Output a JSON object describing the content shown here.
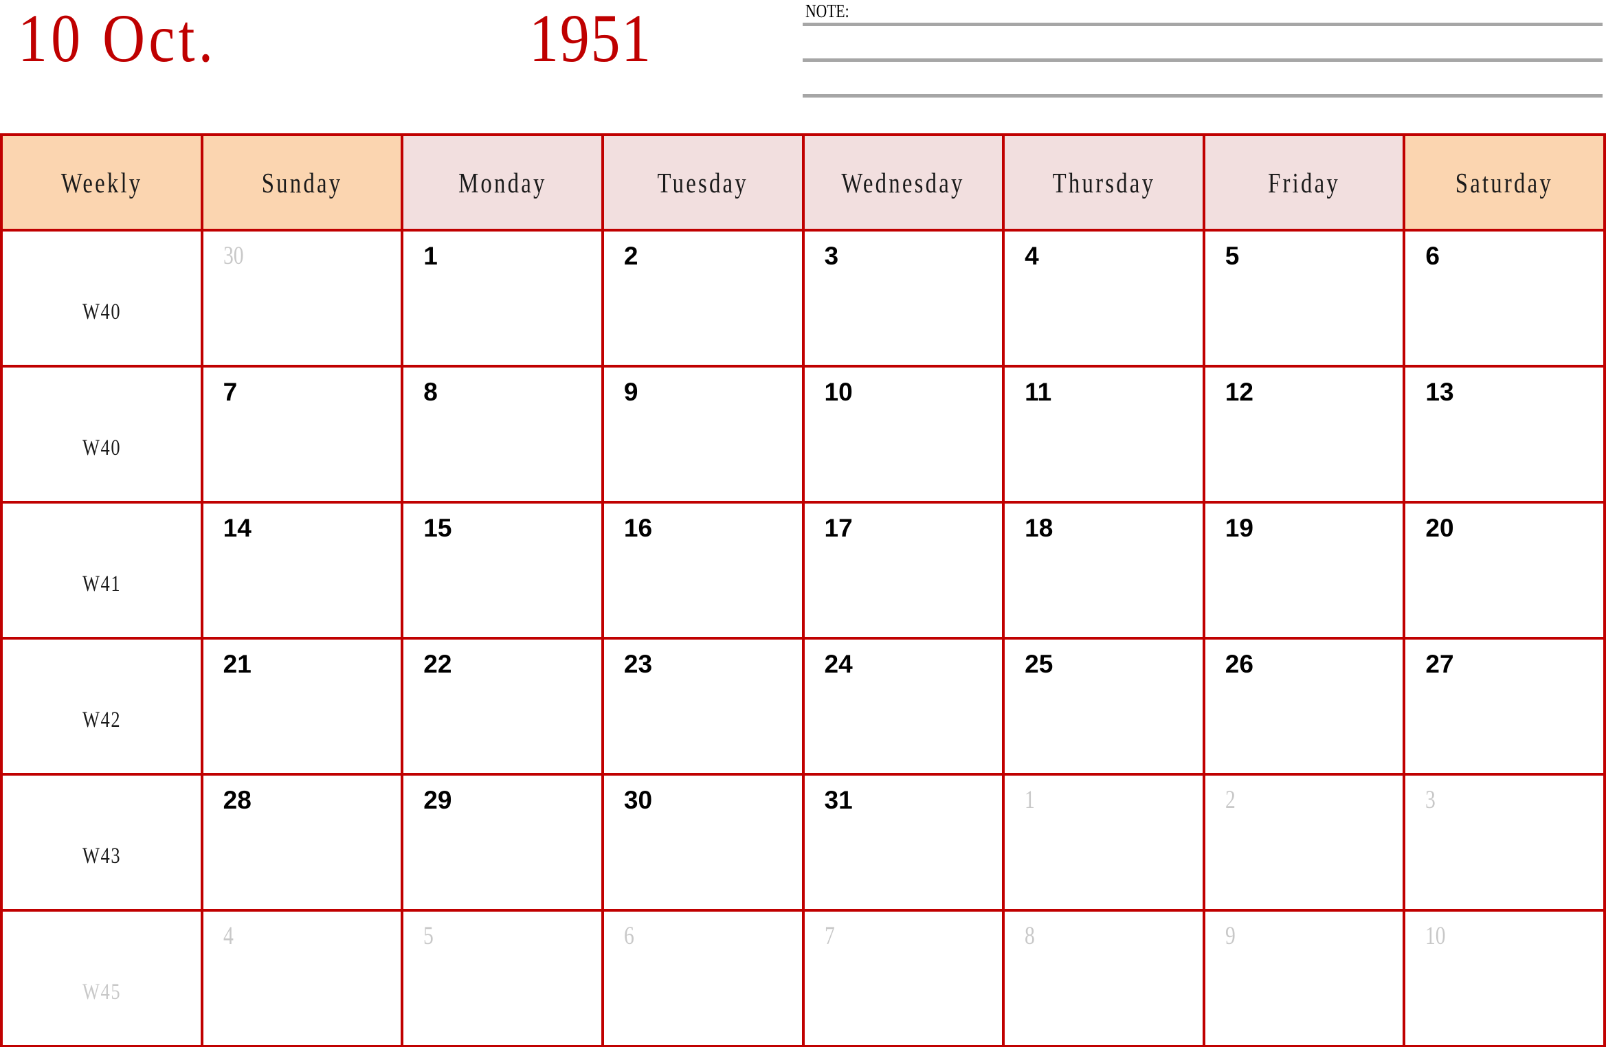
{
  "title": {
    "month": "10 Oct.",
    "year": "1951"
  },
  "note": {
    "label": "NOTE:",
    "lines": 3
  },
  "colors": {
    "grid_red": "#c00000",
    "title_red": "#bf0000",
    "weekend_header_bg": "#fbd5b0",
    "weekday_header_bg": "#f2dfdf",
    "muted_text": "#c8c8c8",
    "note_line": "#a6a6a6"
  },
  "table": {
    "headers": [
      {
        "label": "Weekly",
        "type": "weekend"
      },
      {
        "label": "Sunday",
        "type": "weekend"
      },
      {
        "label": "Monday",
        "type": "weekday"
      },
      {
        "label": "Tuesday",
        "type": "weekday"
      },
      {
        "label": "Wednesday",
        "type": "weekday"
      },
      {
        "label": "Thursday",
        "type": "weekday"
      },
      {
        "label": "Friday",
        "type": "weekday"
      },
      {
        "label": "Saturday",
        "type": "weekend"
      }
    ],
    "weeks": [
      {
        "week_label": "W40",
        "week_muted": false,
        "days": [
          {
            "num": "30",
            "muted": true
          },
          {
            "num": "1",
            "muted": false
          },
          {
            "num": "2",
            "muted": false
          },
          {
            "num": "3",
            "muted": false
          },
          {
            "num": "4",
            "muted": false
          },
          {
            "num": "5",
            "muted": false
          },
          {
            "num": "6",
            "muted": false
          }
        ]
      },
      {
        "week_label": "W40",
        "week_muted": false,
        "days": [
          {
            "num": "7",
            "muted": false
          },
          {
            "num": "8",
            "muted": false
          },
          {
            "num": "9",
            "muted": false
          },
          {
            "num": "10",
            "muted": false
          },
          {
            "num": "11",
            "muted": false
          },
          {
            "num": "12",
            "muted": false
          },
          {
            "num": "13",
            "muted": false
          }
        ]
      },
      {
        "week_label": "W41",
        "week_muted": false,
        "days": [
          {
            "num": "14",
            "muted": false
          },
          {
            "num": "15",
            "muted": false
          },
          {
            "num": "16",
            "muted": false
          },
          {
            "num": "17",
            "muted": false
          },
          {
            "num": "18",
            "muted": false
          },
          {
            "num": "19",
            "muted": false
          },
          {
            "num": "20",
            "muted": false
          }
        ]
      },
      {
        "week_label": "W42",
        "week_muted": false,
        "days": [
          {
            "num": "21",
            "muted": false
          },
          {
            "num": "22",
            "muted": false
          },
          {
            "num": "23",
            "muted": false
          },
          {
            "num": "24",
            "muted": false
          },
          {
            "num": "25",
            "muted": false
          },
          {
            "num": "26",
            "muted": false
          },
          {
            "num": "27",
            "muted": false
          }
        ]
      },
      {
        "week_label": "W43",
        "week_muted": false,
        "days": [
          {
            "num": "28",
            "muted": false
          },
          {
            "num": "29",
            "muted": false
          },
          {
            "num": "30",
            "muted": false
          },
          {
            "num": "31",
            "muted": false
          },
          {
            "num": "1",
            "muted": true
          },
          {
            "num": "2",
            "muted": true
          },
          {
            "num": "3",
            "muted": true
          }
        ]
      },
      {
        "week_label": "W45",
        "week_muted": true,
        "days": [
          {
            "num": "4",
            "muted": true
          },
          {
            "num": "5",
            "muted": true
          },
          {
            "num": "6",
            "muted": true
          },
          {
            "num": "7",
            "muted": true
          },
          {
            "num": "8",
            "muted": true
          },
          {
            "num": "9",
            "muted": true
          },
          {
            "num": "10",
            "muted": true
          }
        ]
      }
    ]
  }
}
